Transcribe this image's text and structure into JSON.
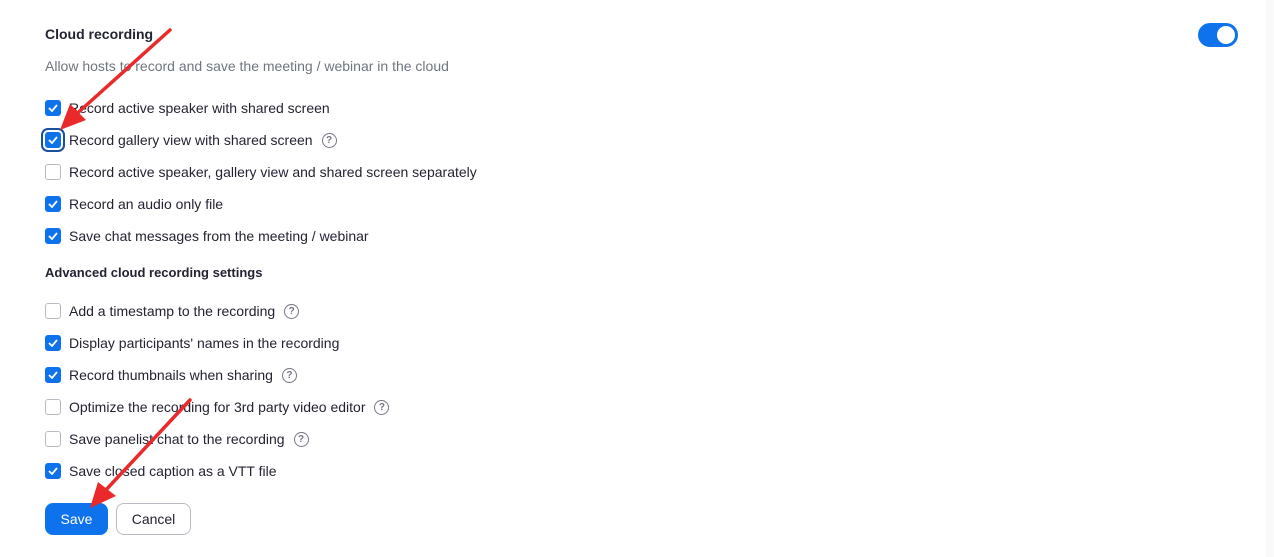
{
  "cloud_recording": {
    "title": "Cloud recording",
    "description": "Allow hosts to record and save the meeting / webinar in the cloud",
    "enabled": true,
    "options": [
      {
        "label": "Record active speaker with shared screen",
        "checked": true,
        "help": false
      },
      {
        "label": "Record gallery view with shared screen",
        "checked": true,
        "help": true,
        "focused": true
      },
      {
        "label": "Record active speaker, gallery view and shared screen separately",
        "checked": false,
        "help": false
      },
      {
        "label": "Record an audio only file",
        "checked": true,
        "help": false
      },
      {
        "label": "Save chat messages from the meeting / webinar",
        "checked": true,
        "help": false
      }
    ]
  },
  "advanced": {
    "title": "Advanced cloud recording settings",
    "options": [
      {
        "label": "Add a timestamp to the recording",
        "checked": false,
        "help": true
      },
      {
        "label": "Display participants' names in the recording",
        "checked": true,
        "help": false
      },
      {
        "label": "Record thumbnails when sharing",
        "checked": true,
        "help": true
      },
      {
        "label": "Optimize the recording for 3rd party video editor",
        "checked": false,
        "help": true
      },
      {
        "label": "Save panelist chat to the recording",
        "checked": false,
        "help": true
      },
      {
        "label": "Save closed caption as a VTT file",
        "checked": true,
        "help": false
      }
    ]
  },
  "help_glyph": "?",
  "buttons": {
    "save": "Save",
    "cancel": "Cancel"
  },
  "colors": {
    "accent": "#0e72ed",
    "annotation_arrow": "#ea2a2a"
  }
}
